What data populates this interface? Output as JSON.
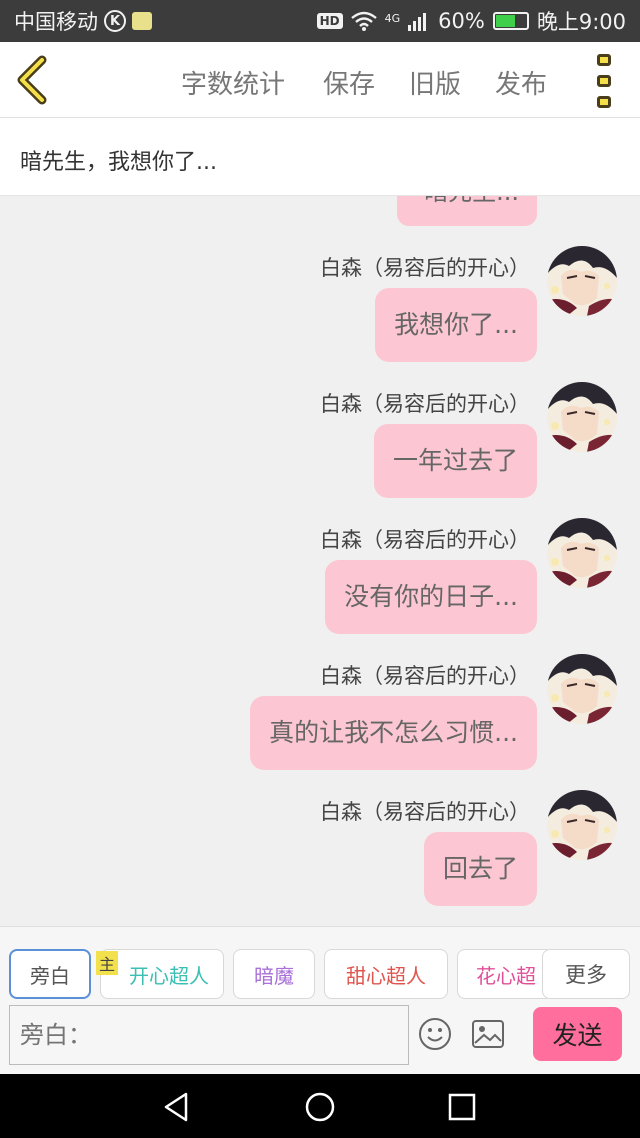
{
  "status_bar": {
    "carrier": "中国移动",
    "k_badge": "K",
    "hd": "HD",
    "network": "4G",
    "battery": "60%",
    "battery_level": 0.6,
    "time": "晚上9:00"
  },
  "header": {
    "nav_items": [
      "字数统计",
      "保存",
      "旧版",
      "发布"
    ],
    "accent_color": "#f5e04a"
  },
  "title": "暗先生，我想你了...",
  "chat": {
    "clipped_bubble_text": "暗先生...",
    "messages": [
      {
        "name": "白森（易容后的开心）",
        "text": "我想你了..."
      },
      {
        "name": "白森（易容后的开心）",
        "text": "一年过去了"
      },
      {
        "name": "白森（易容后的开心）",
        "text": "没有你的日子..."
      },
      {
        "name": "白森（易容后的开心）",
        "text": "真的让我不怎么习惯..."
      },
      {
        "name": "白森（易容后的开心）",
        "text": "回去了"
      }
    ],
    "bubble_color": "#fcc7d3"
  },
  "roles": [
    {
      "label": "旁白",
      "color": "#555555"
    },
    {
      "label": "开心超人",
      "color": "#3bbfb3"
    },
    {
      "label": "暗魔",
      "color": "#a870d8"
    },
    {
      "label": "甜心超人",
      "color": "#e0554f"
    },
    {
      "label": "花心超",
      "color": "#e0509a"
    }
  ],
  "main_tag": "主",
  "more_roles": "更多",
  "input": {
    "placeholder": "旁白："
  },
  "send_label": "发送",
  "send_color": "#ff6e9c"
}
